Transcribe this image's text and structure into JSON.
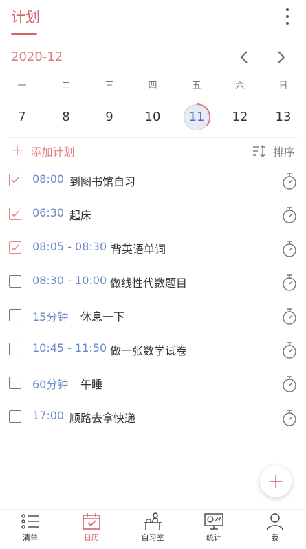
{
  "header": {
    "title": "计划",
    "more_icon": "more-vertical-icon"
  },
  "calendar": {
    "month": "2020-12",
    "weekdays": [
      "一",
      "二",
      "三",
      "四",
      "五",
      "六",
      "日"
    ],
    "days": [
      "7",
      "8",
      "9",
      "10",
      "11",
      "12",
      "13"
    ],
    "selected_day": "11"
  },
  "actions": {
    "add_label": "添加计划",
    "sort_label": "排序"
  },
  "tasks": [
    {
      "time": "08:00",
      "title": "到图书馆自习",
      "done": true
    },
    {
      "time": "06:30",
      "title": "起床",
      "done": true
    },
    {
      "time": "08:05 - 08:30",
      "title": "背英语单词",
      "done": true
    },
    {
      "time": "08:30 - 10:00",
      "title": "做线性代数题目",
      "done": false
    },
    {
      "time": "15分钟",
      "title": "休息一下",
      "done": false
    },
    {
      "time": "10:45 - 11:50",
      "title": "做一张数学试卷",
      "done": false
    },
    {
      "time": "60分钟",
      "title": "午睡",
      "done": false
    },
    {
      "time": "17:00",
      "title": "顺路去拿快递",
      "done": false
    }
  ],
  "fab": {
    "icon": "plus-icon"
  },
  "bottom_nav": {
    "active": "日历",
    "tabs": [
      {
        "label": "清单",
        "icon": "list-icon"
      },
      {
        "label": "日历",
        "icon": "calendar-icon"
      },
      {
        "label": "自习室",
        "icon": "study-room-icon"
      },
      {
        "label": "统计",
        "icon": "statistics-icon"
      },
      {
        "label": "我",
        "icon": "profile-icon"
      }
    ]
  },
  "colors": {
    "accent": "#d06668",
    "time_text": "#6a8ac8",
    "selected_day_bg": "#e8ebf6"
  }
}
